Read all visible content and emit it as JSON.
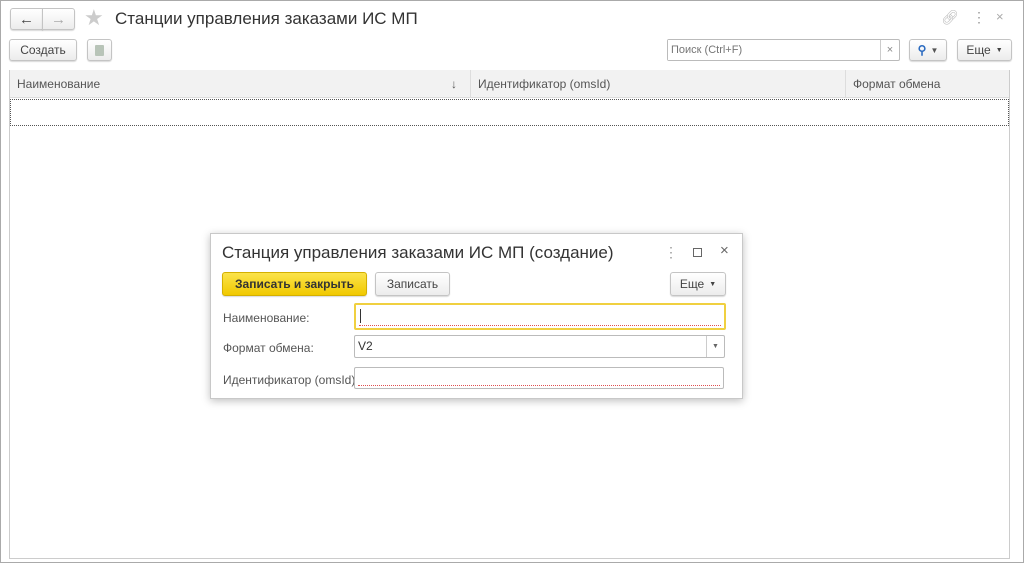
{
  "window": {
    "title": "Станции управления заказами ИС МП"
  },
  "toolbar": {
    "create_label": "Создать",
    "search_placeholder": "Поиск (Ctrl+F)",
    "search_clear": "×",
    "more_label": "Еще"
  },
  "table": {
    "columns": [
      "Наименование",
      "Идентификатор (omsId)",
      "Формат обмена"
    ],
    "sort_indicator": "↓",
    "rows": []
  },
  "dialog": {
    "title": "Станция управления заказами ИС МП (создание)",
    "save_close_label": "Записать и закрыть",
    "save_label": "Записать",
    "more_label": "Еще",
    "fields": [
      {
        "label": "Наименование:",
        "value": ""
      },
      {
        "label": "Формат обмена:",
        "value": "V2"
      },
      {
        "label": "Идентификатор (omsId):",
        "value": ""
      }
    ]
  },
  "colors": {
    "accent_yellow": "#f5d10f",
    "mark_required": "#e05050"
  }
}
